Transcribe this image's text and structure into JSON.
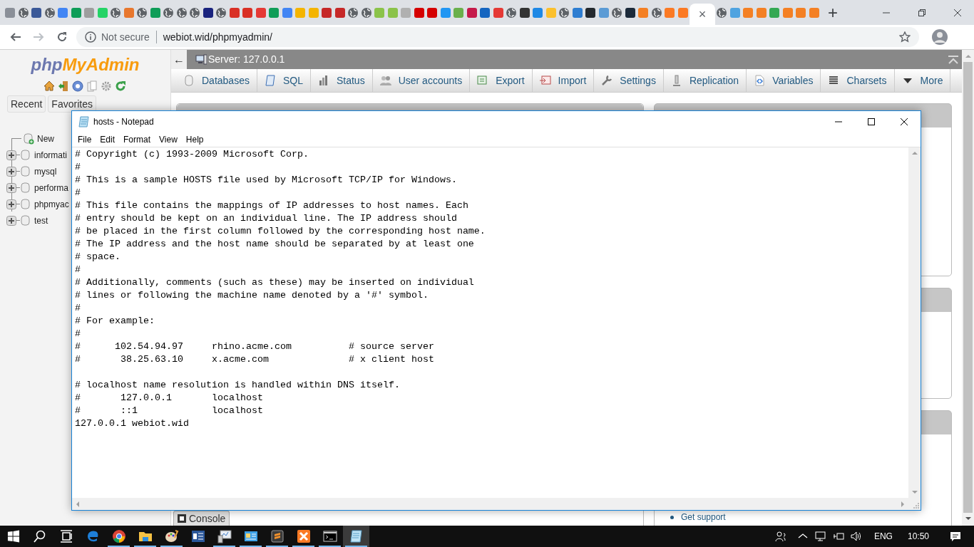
{
  "browser": {
    "tabs": [
      {
        "kind": "site",
        "color": "#8a8f98",
        "selected": false
      },
      {
        "kind": "globe",
        "selected": false
      },
      {
        "kind": "site",
        "color": "#3b5998",
        "selected": false
      },
      {
        "kind": "globe",
        "selected": false
      },
      {
        "kind": "site",
        "color": "#4285f4",
        "selected": false
      },
      {
        "kind": "site",
        "color": "#0f9d58",
        "selected": false
      },
      {
        "kind": "site",
        "color": "#9e9e9e",
        "selected": false
      },
      {
        "kind": "site",
        "color": "#25d366",
        "selected": false
      },
      {
        "kind": "globe",
        "selected": false
      },
      {
        "kind": "site",
        "color": "#e8772e",
        "selected": false
      },
      {
        "kind": "globe",
        "selected": false
      },
      {
        "kind": "site",
        "color": "#0f9d58",
        "selected": false
      },
      {
        "kind": "globe",
        "selected": false
      },
      {
        "kind": "globe",
        "selected": false
      },
      {
        "kind": "globe",
        "selected": false
      },
      {
        "kind": "site",
        "color": "#1a237e",
        "selected": false
      },
      {
        "kind": "globe",
        "selected": false
      },
      {
        "kind": "site",
        "color": "#d93025",
        "selected": false
      },
      {
        "kind": "site",
        "color": "#d93025",
        "selected": false
      },
      {
        "kind": "site",
        "color": "#e53935",
        "selected": false
      },
      {
        "kind": "site",
        "color": "#0f9d58",
        "selected": false
      },
      {
        "kind": "site",
        "color": "#4285f4",
        "selected": false
      },
      {
        "kind": "site",
        "color": "#f4b400",
        "selected": false
      },
      {
        "kind": "site",
        "color": "#f4b400",
        "selected": false
      },
      {
        "kind": "site",
        "color": "#c62828",
        "selected": false
      },
      {
        "kind": "site",
        "color": "#c62828",
        "selected": false
      },
      {
        "kind": "globe",
        "selected": false
      },
      {
        "kind": "globe",
        "selected": false
      },
      {
        "kind": "site",
        "color": "#8bc34a",
        "selected": false
      },
      {
        "kind": "site",
        "color": "#8bc34a",
        "selected": false
      },
      {
        "kind": "site",
        "color": "#b0b0b0",
        "selected": false
      },
      {
        "kind": "site",
        "color": "#d50000",
        "selected": false
      },
      {
        "kind": "site",
        "color": "#d50000",
        "selected": false
      },
      {
        "kind": "site",
        "color": "#2196f3",
        "selected": false
      },
      {
        "kind": "site",
        "color": "#6ab04c",
        "selected": false
      },
      {
        "kind": "site",
        "color": "#c51a4a",
        "selected": false
      },
      {
        "kind": "site",
        "color": "#1565c0",
        "selected": false
      },
      {
        "kind": "site",
        "color": "#e53935",
        "selected": false
      },
      {
        "kind": "globe",
        "selected": false
      },
      {
        "kind": "site",
        "color": "#333333",
        "selected": false
      },
      {
        "kind": "site",
        "color": "#1e88e5",
        "selected": false
      },
      {
        "kind": "site",
        "color": "#fbc02d",
        "selected": false
      },
      {
        "kind": "globe",
        "selected": false
      },
      {
        "kind": "site",
        "color": "#2e7dd1",
        "selected": false
      },
      {
        "kind": "site",
        "color": "#24292e",
        "selected": false
      },
      {
        "kind": "site",
        "color": "#5b9bd5",
        "selected": false
      },
      {
        "kind": "globe",
        "selected": false
      },
      {
        "kind": "site",
        "color": "#1b2a3a",
        "selected": false
      },
      {
        "kind": "site",
        "color": "#f48024",
        "selected": false
      },
      {
        "kind": "globe",
        "selected": false
      },
      {
        "kind": "site",
        "color": "#fb7a24",
        "selected": false
      },
      {
        "kind": "site",
        "color": "#fb7a24",
        "selected": false
      },
      {
        "kind": "page",
        "close": "×",
        "selected": true
      },
      {
        "kind": "globe",
        "selected": false
      },
      {
        "kind": "site",
        "color": "#4fa3e0",
        "selected": false
      },
      {
        "kind": "site",
        "color": "#f48024",
        "selected": false
      },
      {
        "kind": "site",
        "color": "#f48024",
        "selected": false
      },
      {
        "kind": "site",
        "color": "#34a853",
        "selected": false
      },
      {
        "kind": "site",
        "color": "#f48024",
        "selected": false
      },
      {
        "kind": "site",
        "color": "#f48024",
        "selected": false
      },
      {
        "kind": "site",
        "color": "#f48024",
        "selected": false
      }
    ],
    "new_tab": "+",
    "address_bar": {
      "security": "Not secure",
      "url": "webiot.wid/phpmyadmin/"
    }
  },
  "sidebar": {
    "logo": {
      "part_1": "php",
      "part_2": "MyAdmin"
    },
    "buttons": [
      "Recent",
      "Favorites"
    ],
    "tree": [
      {
        "kind": "new",
        "label": "New"
      },
      {
        "kind": "database",
        "label": "informati"
      },
      {
        "kind": "database",
        "label": "mysql"
      },
      {
        "kind": "database",
        "label": "performa"
      },
      {
        "kind": "database",
        "label": "phpmyac"
      },
      {
        "kind": "database",
        "label": "test"
      }
    ]
  },
  "server_bar": {
    "back": "←",
    "title": "Server: 127.0.0.1"
  },
  "nav_tabs": [
    {
      "kind": "database",
      "label": "Databases"
    },
    {
      "kind": "sql",
      "label": "SQL"
    },
    {
      "kind": "status",
      "label": "Status"
    },
    {
      "kind": "users",
      "label": "User accounts"
    },
    {
      "kind": "export",
      "label": "Export"
    },
    {
      "kind": "import",
      "label": "Import"
    },
    {
      "kind": "settings",
      "label": "Settings"
    },
    {
      "kind": "replication",
      "label": "Replication"
    },
    {
      "kind": "variables",
      "label": "Variables"
    },
    {
      "kind": "charsets",
      "label": "Charsets"
    },
    {
      "kind": "more",
      "label": "More"
    }
  ],
  "panel_links": [
    "Get support"
  ],
  "console": {
    "label": "Console"
  },
  "notepad": {
    "title": "hosts - Notepad",
    "menu": [
      "File",
      "Edit",
      "Format",
      "View",
      "Help"
    ],
    "text": "# Copyright (c) 1993-2009 Microsoft Corp.\n#\n# This is a sample HOSTS file used by Microsoft TCP/IP for Windows.\n#\n# This file contains the mappings of IP addresses to host names. Each\n# entry should be kept on an individual line. The IP address should\n# be placed in the first column followed by the corresponding host name.\n# The IP address and the host name should be separated by at least one\n# space.\n#\n# Additionally, comments (such as these) may be inserted on individual\n# lines or following the machine name denoted by a '#' symbol.\n#\n# For example:\n#\n#      102.54.94.97     rhino.acme.com          # source server\n#       38.25.63.10     x.acme.com              # x client host\n\n# localhost name resolution is handled within DNS itself.\n#       127.0.0.1       localhost\n#       ::1             localhost\n127.0.0.1 webiot.wid"
  },
  "taskbar": {
    "apps": [
      {
        "kind": "edge",
        "running": false,
        "selected": false
      },
      {
        "kind": "chrome",
        "running": true,
        "selected": false
      },
      {
        "kind": "explorer",
        "running": true,
        "selected": false
      },
      {
        "kind": "paint",
        "running": true,
        "selected": false
      },
      {
        "kind": "word",
        "running": false,
        "selected": false
      },
      {
        "kind": "monitor",
        "running": true,
        "selected": false
      },
      {
        "kind": "panel",
        "running": true,
        "selected": false
      },
      {
        "kind": "sublime",
        "running": true,
        "selected": false
      },
      {
        "kind": "xampp",
        "running": true,
        "selected": false
      },
      {
        "kind": "cmd",
        "running": true,
        "selected": false
      },
      {
        "kind": "notepad",
        "running": true,
        "selected": true
      }
    ],
    "language": "ENG",
    "time": "10:50"
  }
}
